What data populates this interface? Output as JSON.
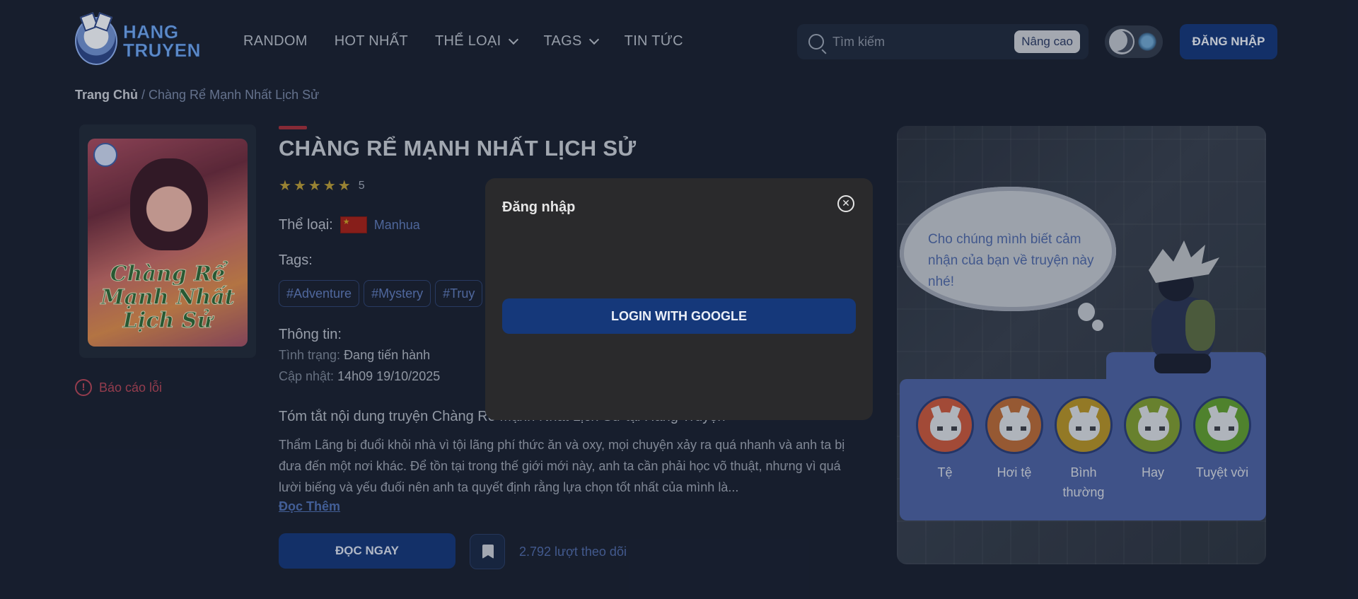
{
  "header": {
    "logo_line1": "HANG",
    "logo_line2": "TRUYEN",
    "nav": [
      {
        "label": "RANDOM"
      },
      {
        "label": "HOT NHẤT"
      },
      {
        "label": "THỂ LOẠI"
      },
      {
        "label": "TAGS"
      },
      {
        "label": "TIN TỨC"
      }
    ],
    "search": {
      "placeholder": "Tìm kiếm",
      "advanced_label": "Nâng cao"
    },
    "login_label": "ĐĂNG NHẬP"
  },
  "breadcrumb": {
    "home": "Trang Chủ",
    "separator": " / ",
    "current": "Chàng Rể Mạnh Nhất Lịch Sử"
  },
  "cover": {
    "title": "Chàng Rể Mạnh Nhất Lịch Sử"
  },
  "report_label": "Báo cáo lỗi",
  "manga": {
    "title": "CHÀNG RỂ MẠNH NHẤT LỊCH SỬ",
    "rating": 5,
    "rating_text": "5",
    "genre_label": "Thể loại:",
    "genre_value": "Manhua",
    "tags_label": "Tags:",
    "tags": [
      "#Adventure",
      "#Mystery",
      "#Truy"
    ],
    "info_label": "Thông tin:",
    "status_key": "Tình trạng:",
    "status_value": "Đang tiến hành",
    "updated_key": "Cập nhật:",
    "updated_value": "14h09 19/10/2025",
    "summary_title": "Tóm tắt nội dung truyện Chàng Rể Mạnh Nhất Lịch Sử tại Hang Truyện",
    "summary": "Thẩm Lãng bị đuổi khỏi nhà vì tội lãng phí thức ăn và oxy, mọi chuyện xảy ra quá nhanh và anh ta bị đưa đến một nơi khác. Để tồn tại trong thế giới mới này, anh ta cần phải học võ thuật, nhưng vì quá lười biếng và yếu đuối nên anh ta quyết định rằng lựa chọn tốt nhất của mình là...",
    "read_more": "Đọc Thêm",
    "read_now": "ĐỌC NGAY",
    "followers": "2.792 lượt theo dõi"
  },
  "feedback": {
    "bubble_text": "Cho chúng mình biết cảm nhận của bạn về truyện này nhé!",
    "reactions": [
      {
        "label": "Tệ",
        "color": "#c4573f"
      },
      {
        "label": "Hơi tệ",
        "color": "#b5693a"
      },
      {
        "label": "Bình thường",
        "color": "#b1912a"
      },
      {
        "label": "Hay",
        "color": "#7d9a34"
      },
      {
        "label": "Tuyệt vời",
        "color": "#5f9b32"
      }
    ]
  },
  "modal": {
    "title": "Đăng nhập",
    "google_label": "LOGIN WITH GOOGLE"
  }
}
